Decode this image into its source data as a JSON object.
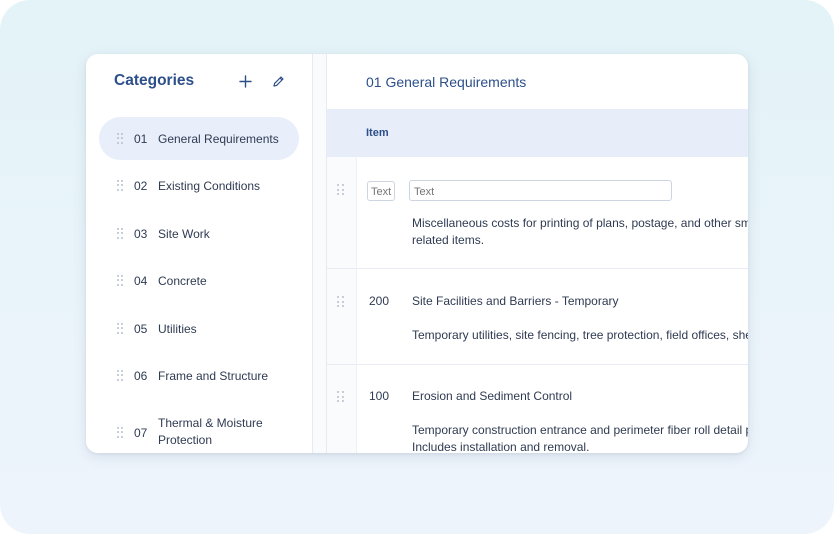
{
  "sidebar": {
    "title": "Categories",
    "add_icon": "plus-icon",
    "edit_icon": "pencil-icon",
    "items": [
      {
        "num": "01",
        "label": "General Requirements"
      },
      {
        "num": "02",
        "label": "Existing Conditions"
      },
      {
        "num": "03",
        "label": "Site Work"
      },
      {
        "num": "04",
        "label": "Concrete"
      },
      {
        "num": "05",
        "label": "Utilities"
      },
      {
        "num": "06",
        "label": "Frame and Structure"
      },
      {
        "num": "07",
        "label": "Thermal & Moisture Protection"
      }
    ]
  },
  "main": {
    "title": "01 General Requirements",
    "header": {
      "item": "Item"
    },
    "rows": [
      {
        "code_placeholder": "Text",
        "title_placeholder": "Text",
        "desc_line1": "Miscellaneous costs for printing of plans, postage, and other small p",
        "desc_line2": "related items."
      },
      {
        "code": "200",
        "title": "Site Facilities and Barriers - Temporary",
        "desc_line1": "Temporary utilities, site fencing, tree protection, field offices, sheds"
      },
      {
        "code": "100",
        "title": "Erosion and Sediment Control",
        "desc_line1": "Temporary construction entrance and perimeter fiber roll detail per",
        "desc_line2": "Includes installation and removal."
      }
    ]
  },
  "colors": {
    "accent": "#2d4f8a",
    "active_bg": "#e8eefa",
    "header_bg": "#e7eef9"
  }
}
